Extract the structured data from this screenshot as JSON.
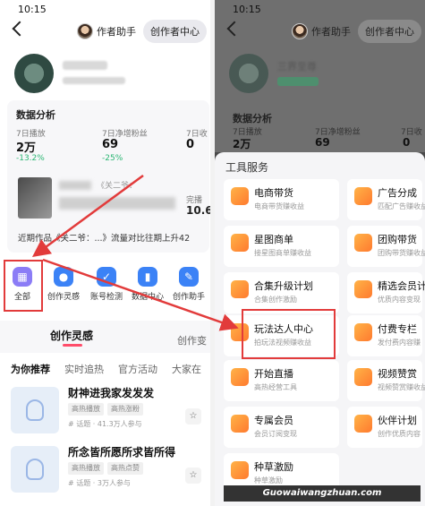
{
  "left": {
    "status_time": "10:15",
    "segment": {
      "assistant": "作者助手",
      "center": "创作者中心"
    },
    "data_section": {
      "title": "数据分析",
      "stats": [
        {
          "label": "7日播放",
          "value": "2万",
          "change": "-13.2%"
        },
        {
          "label": "7日净增粉丝",
          "value": "69",
          "change": "-25%"
        },
        {
          "label": "7日收",
          "value": "0",
          "change": ""
        }
      ]
    },
    "video_row": {
      "fragment": "《关二爷：",
      "right_label": "完播",
      "right_value": "10.6"
    },
    "recent_text": "近期作品《关二爷：...》流量对比往期上升42",
    "tools": [
      {
        "label": "全部",
        "icon": "grid-icon",
        "color": "#8b7cf6"
      },
      {
        "label": "创作灵感",
        "icon": "bulb-icon",
        "color": "#3b82f6"
      },
      {
        "label": "账号检测",
        "icon": "user-check-icon",
        "color": "#3b82f6"
      },
      {
        "label": "数据中心",
        "icon": "chart-icon",
        "color": "#3b82f6"
      },
      {
        "label": "创作助手",
        "icon": "assistant-icon",
        "color": "#3b82f6"
      }
    ],
    "main_tabs": {
      "active": "创作灵感",
      "other": "创作变"
    },
    "sub_tabs": [
      "为你推荐",
      "实时追热",
      "官方活动",
      "大家在"
    ],
    "ideas": [
      {
        "title": "财神进我家发发发",
        "chips": [
          "高热播放",
          "高热涨粉"
        ],
        "meta": "# 话题 · 41.3万人参与"
      },
      {
        "title": "所念皆所愿所求皆所得",
        "chips": [
          "高热播放",
          "高热点赞"
        ],
        "meta": "# 话题 · 3万人参与"
      }
    ]
  },
  "right": {
    "status_time": "10:15",
    "segment": {
      "assistant": "作者助手",
      "center": "创作者中心"
    },
    "profile_name": "三界至尊",
    "data_title": "数据分析",
    "stats": [
      {
        "label": "7日播放",
        "value": "2万",
        "change": "-13.2%"
      },
      {
        "label": "7日净增粉丝",
        "value": "69",
        "change": "-25%"
      },
      {
        "label": "7日收",
        "value": "0",
        "change": ""
      }
    ],
    "sheet_title": "工具服务",
    "services_left": [
      {
        "name": "电商带货",
        "desc": "电商带货赚收益"
      },
      {
        "name": "星图商单",
        "desc": "接星图商单赚收益"
      },
      {
        "name": "合集升级计划",
        "desc": "合集创作激励"
      },
      {
        "name": "玩法达人中心",
        "desc": "拍玩法视频赚收益"
      },
      {
        "name": "开始直播",
        "desc": "高热经营工具"
      },
      {
        "name": "专属会员",
        "desc": "会员订阅变现"
      },
      {
        "name": "种草激励",
        "desc": "种草激励"
      }
    ],
    "services_right": [
      {
        "name": "广告分成",
        "desc": "匹配广告赚收益"
      },
      {
        "name": "团购带货",
        "desc": "团购带货赚收益"
      },
      {
        "name": "精选会员计",
        "desc": "优质内容变现"
      },
      {
        "name": "付费专栏",
        "desc": "发付费内容赚"
      },
      {
        "name": "视频赞赏",
        "desc": "视频赞赏赚收益"
      },
      {
        "name": "伙伴计划",
        "desc": "创作优质内容"
      }
    ]
  },
  "watermark": "Guowaiwangzhuan.com",
  "colors": {
    "highlight_red": "#e23b3b",
    "positive_green": "#2bb673",
    "tab_underline": "#ff4d6a"
  }
}
